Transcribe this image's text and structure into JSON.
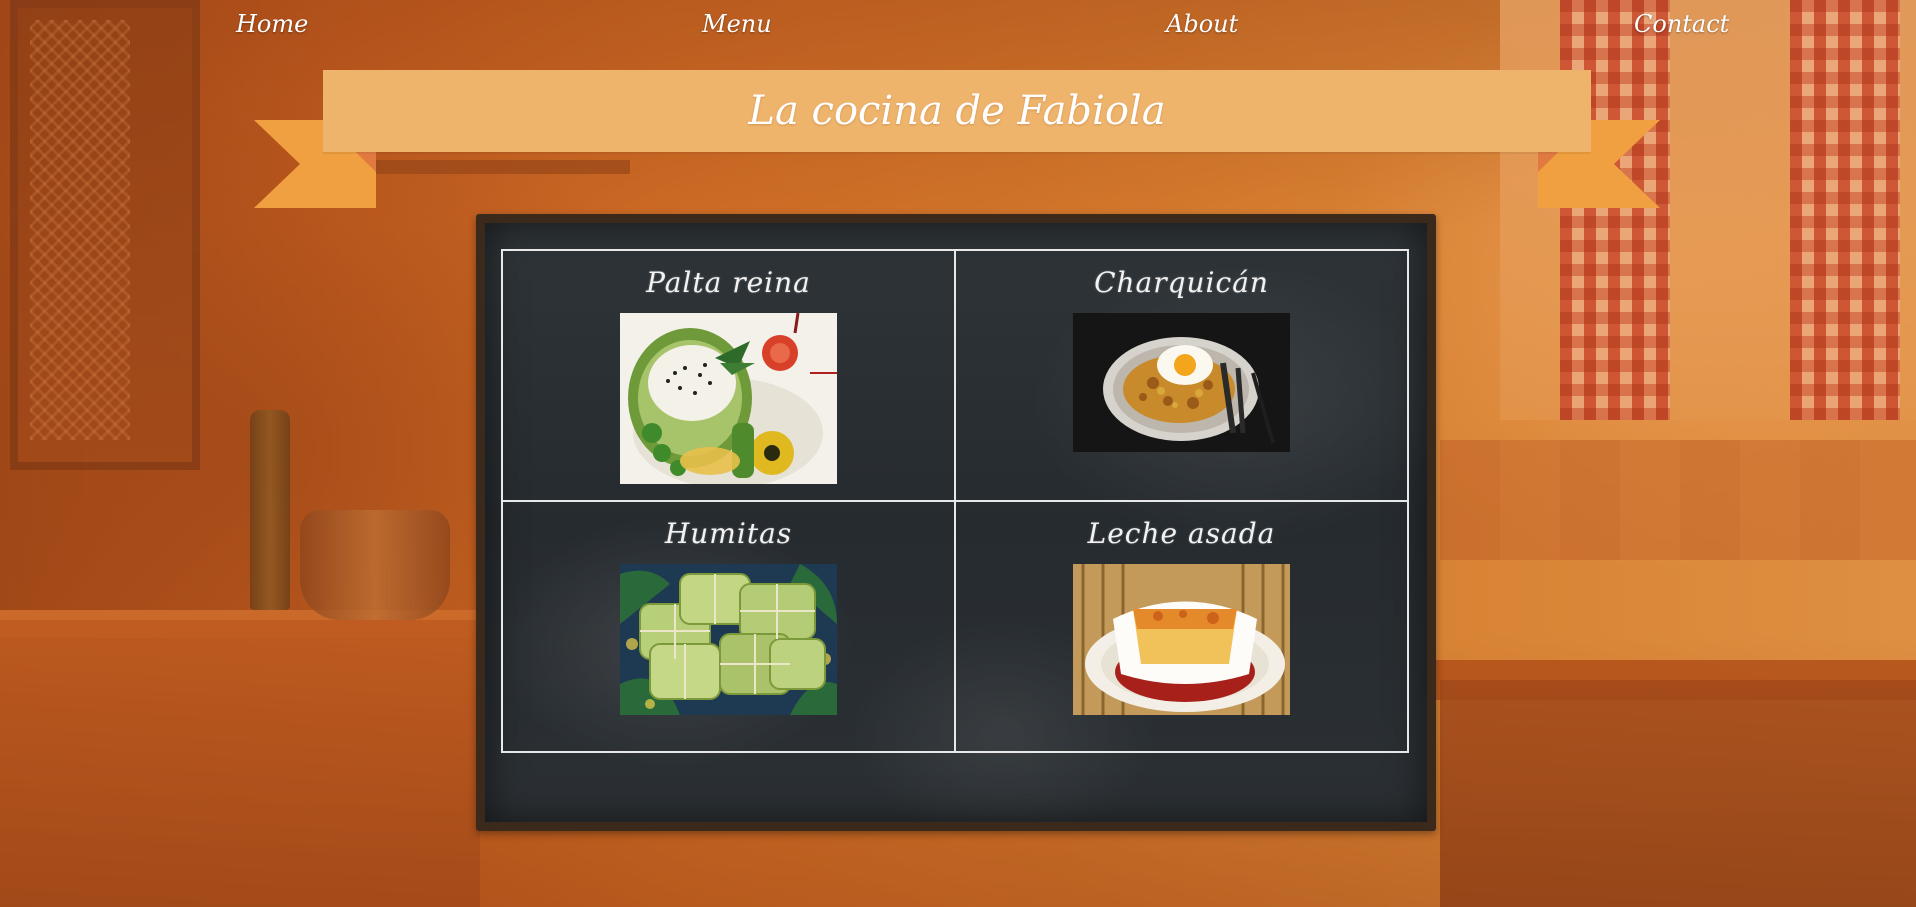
{
  "nav": {
    "items": [
      {
        "label": "Home"
      },
      {
        "label": "Menu"
      },
      {
        "label": "About"
      },
      {
        "label": "Contact"
      }
    ]
  },
  "banner": {
    "title": "La cocina de Fabiola"
  },
  "menu": {
    "dishes": [
      {
        "name": "Palta reina",
        "photo": "stuffed-avocado-photo"
      },
      {
        "name": "Charquicán",
        "photo": "charquican-with-fried-egg-photo"
      },
      {
        "name": "Humitas",
        "photo": "humitas-corn-husk-parcels-photo"
      },
      {
        "name": "Leche asada",
        "photo": "leche-asada-custard-photo"
      }
    ]
  },
  "colors": {
    "banner": "#efb46c",
    "ribbon": "#f0a040",
    "ribbon_fold": "#e07a40",
    "board_frame": "#3b2a1c",
    "chalkboard": "#2a2f33",
    "text": "#ffffff"
  }
}
